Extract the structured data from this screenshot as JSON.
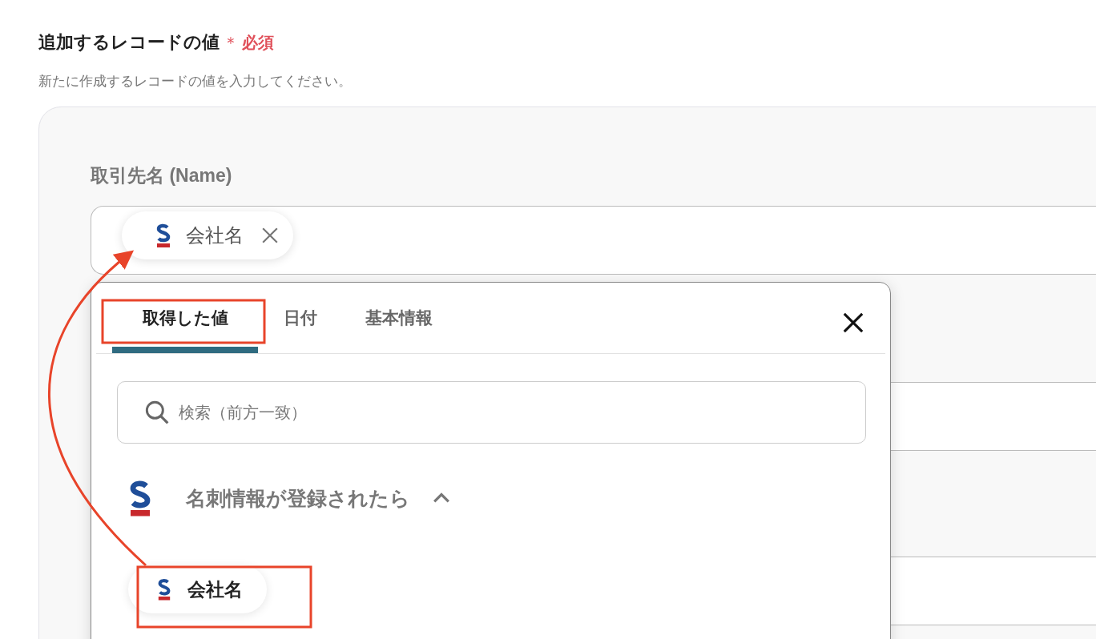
{
  "section": {
    "title": "追加するレコードの値",
    "required_mark": "＊",
    "required_label": "必須",
    "description": "新たに作成するレコードの値を入力してください。"
  },
  "field": {
    "label": "取引先名 (Name)",
    "chip": {
      "label": "会社名"
    }
  },
  "popup": {
    "tabs": [
      {
        "label": "取得した値",
        "selected": true
      },
      {
        "label": "日付",
        "selected": false
      },
      {
        "label": "基本情報",
        "selected": false
      }
    ],
    "search": {
      "placeholder": "検索（前方一致）"
    },
    "group": {
      "title": "名刺情報が登録されたら",
      "expanded": true,
      "items": [
        {
          "label": "会社名"
        }
      ]
    }
  }
}
